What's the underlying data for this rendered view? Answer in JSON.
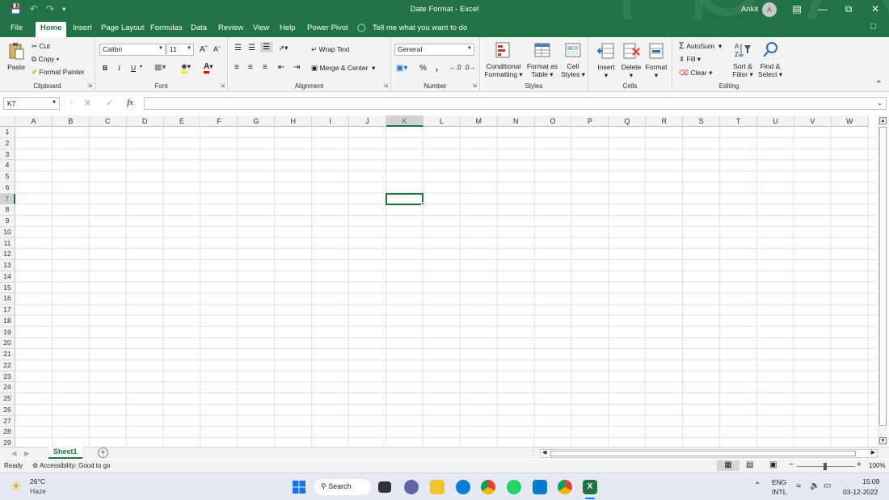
{
  "titlebar": {
    "title": "Date Format  -  Excel",
    "user": "Ankit",
    "avatar": "A"
  },
  "menu": {
    "tabs": [
      "File",
      "Home",
      "Insert",
      "Page Layout",
      "Formulas",
      "Data",
      "Review",
      "View",
      "Help",
      "Power Pivot"
    ],
    "active": "Home",
    "tellme": "Tell me what you want to do"
  },
  "ribbon": {
    "clipboard": {
      "label": "Clipboard",
      "paste": "Paste",
      "cut": "Cut",
      "copy": "Copy",
      "format_painter": "Format Painter"
    },
    "font": {
      "label": "Font",
      "name": "Calibri",
      "size": "11",
      "bold": "B",
      "italic": "I",
      "underline": "U",
      "grow": "A",
      "shrink": "A",
      "font_color": "A"
    },
    "alignment": {
      "label": "Alignment",
      "wrap": "Wrap Text",
      "merge": "Merge & Center"
    },
    "number": {
      "label": "Number",
      "format": "General",
      "percent": "%",
      "comma": ","
    },
    "styles": {
      "label": "Styles",
      "conditional": [
        "Conditional",
        "Formatting"
      ],
      "format_table": [
        "Format as",
        "Table"
      ],
      "cell_styles": [
        "Cell",
        "Styles"
      ]
    },
    "cells": {
      "label": "Cells",
      "insert": "Insert",
      "delete": "Delete",
      "format": "Format"
    },
    "editing": {
      "label": "Editing",
      "autosum": "AutoSum",
      "fill": "Fill",
      "clear": "Clear",
      "sort": [
        "Sort &",
        "Filter"
      ],
      "find": [
        "Find &",
        "Select"
      ]
    }
  },
  "formula": {
    "namebox": "K7",
    "fx": "fx",
    "content": ""
  },
  "grid": {
    "columns": [
      "A",
      "B",
      "C",
      "D",
      "E",
      "F",
      "G",
      "H",
      "I",
      "J",
      "K",
      "L",
      "M",
      "N",
      "O",
      "P",
      "Q",
      "R",
      "S",
      "T",
      "U",
      "V",
      "W"
    ],
    "rows": [
      "1",
      "2",
      "3",
      "4",
      "5",
      "6",
      "7",
      "8",
      "9",
      "10",
      "11",
      "12",
      "13",
      "14",
      "15",
      "16",
      "17",
      "18",
      "19",
      "20",
      "21",
      "22",
      "23",
      "24",
      "25",
      "26",
      "27",
      "28",
      "29"
    ],
    "selected_col": "K",
    "selected_row": "7"
  },
  "sheets": {
    "tabs": [
      "Sheet1"
    ]
  },
  "status": {
    "ready": "Ready",
    "accessibility": "Accessibility: Good to go",
    "zoom": "100%"
  },
  "taskbar": {
    "temp": "26°C",
    "weather": "Haze",
    "search": "Search",
    "lang1": "ENG",
    "lang2": "INTL",
    "time": "15:09",
    "date": "03-12-2022"
  },
  "colors": {
    "accent": "#217346"
  }
}
